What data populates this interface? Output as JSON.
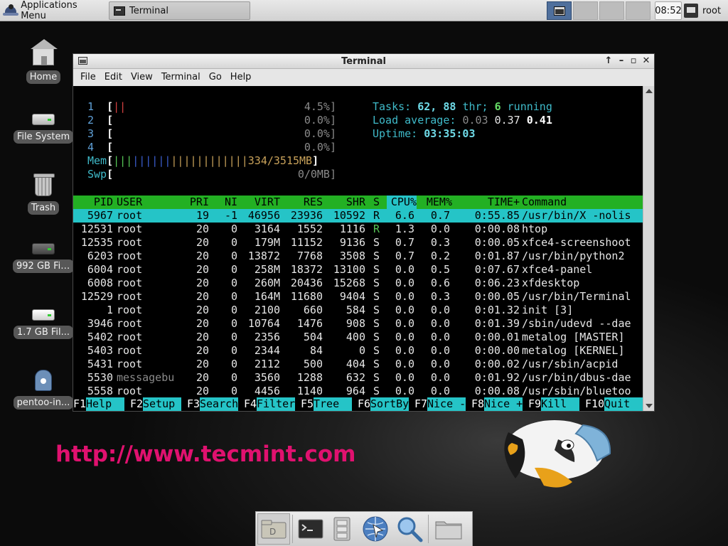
{
  "top_panel": {
    "apps_menu_label": "Applications Menu",
    "task_label": "Terminal",
    "clock": "08:52",
    "user": "root"
  },
  "desktop_icons": [
    {
      "label": "Home",
      "icon": "home-folder-icon"
    },
    {
      "label": "File System",
      "icon": "drive-icon"
    },
    {
      "label": "Trash",
      "icon": "trash-icon"
    },
    {
      "label": "992 GB Fil...",
      "icon": "drive-icon"
    },
    {
      "label": "1.7 GB Fil...",
      "icon": "drive-icon"
    },
    {
      "label": "pentoo-in...",
      "icon": "installer-icon"
    }
  ],
  "terminal": {
    "title": "Terminal",
    "menu": [
      "File",
      "Edit",
      "View",
      "Terminal",
      "Go",
      "Help"
    ]
  },
  "htop": {
    "cpus": [
      {
        "n": "1",
        "bars": "||",
        "pct": "4.5%]"
      },
      {
        "n": "2",
        "bars": "",
        "pct": "0.0%]"
      },
      {
        "n": "3",
        "bars": "",
        "pct": "0.0%]"
      },
      {
        "n": "4",
        "bars": "",
        "pct": "0.0%]"
      }
    ],
    "mem_label": "Mem",
    "mem_value": "334/3515MB",
    "swp_label": "Swp",
    "swp_value": "0/0MB]",
    "tasks_label": "Tasks:",
    "tasks_count": "62,",
    "threads": "88",
    "thr_label": "thr;",
    "running_count": "6",
    "running_label": "running",
    "load_label": "Load average:",
    "load_1": "0.03",
    "load_5": "0.37",
    "load_15": "0.41",
    "uptime_label": "Uptime:",
    "uptime": "03:35:03",
    "headers": {
      "pid": "PID",
      "user": "USER",
      "pri": "PRI",
      "ni": "NI",
      "virt": "VIRT",
      "res": "RES",
      "shr": "SHR",
      "s": "S",
      "cpu": "CPU%",
      "mem": "MEM%",
      "time": "TIME+",
      "cmd": "Command"
    },
    "processes": [
      {
        "pid": "5967",
        "user": "root",
        "pri": "19",
        "ni": "-1",
        "virt": "46956",
        "res": "23936",
        "shr": "10592",
        "s": "R",
        "cpu": "6.6",
        "mem": "0.7",
        "time": "0:55.85",
        "cmd": "/usr/bin/X -nolis"
      },
      {
        "pid": "12531",
        "user": "root",
        "pri": "20",
        "ni": "0",
        "virt": "3164",
        "res": "1552",
        "shr": "1116",
        "s": "R",
        "cpu": "1.3",
        "mem": "0.0",
        "time": "0:00.08",
        "cmd": "htop"
      },
      {
        "pid": "12535",
        "user": "root",
        "pri": "20",
        "ni": "0",
        "virt": "179M",
        "res": "11152",
        "shr": "9136",
        "s": "S",
        "cpu": "0.7",
        "mem": "0.3",
        "time": "0:00.05",
        "cmd": "xfce4-screenshoot"
      },
      {
        "pid": "6203",
        "user": "root",
        "pri": "20",
        "ni": "0",
        "virt": "13872",
        "res": "7768",
        "shr": "3508",
        "s": "S",
        "cpu": "0.7",
        "mem": "0.2",
        "time": "0:01.87",
        "cmd": "/usr/bin/python2"
      },
      {
        "pid": "6004",
        "user": "root",
        "pri": "20",
        "ni": "0",
        "virt": "258M",
        "res": "18372",
        "shr": "13100",
        "s": "S",
        "cpu": "0.0",
        "mem": "0.5",
        "time": "0:07.67",
        "cmd": "xfce4-panel"
      },
      {
        "pid": "6008",
        "user": "root",
        "pri": "20",
        "ni": "0",
        "virt": "260M",
        "res": "20436",
        "shr": "15268",
        "s": "S",
        "cpu": "0.0",
        "mem": "0.6",
        "time": "0:06.23",
        "cmd": "xfdesktop"
      },
      {
        "pid": "12529",
        "user": "root",
        "pri": "20",
        "ni": "0",
        "virt": "164M",
        "res": "11680",
        "shr": "9404",
        "s": "S",
        "cpu": "0.0",
        "mem": "0.3",
        "time": "0:00.05",
        "cmd": "/usr/bin/Terminal"
      },
      {
        "pid": "1",
        "user": "root",
        "pri": "20",
        "ni": "0",
        "virt": "2100",
        "res": "660",
        "shr": "584",
        "s": "S",
        "cpu": "0.0",
        "mem": "0.0",
        "time": "0:01.32",
        "cmd": "init [3]"
      },
      {
        "pid": "3946",
        "user": "root",
        "pri": "20",
        "ni": "0",
        "virt": "10764",
        "res": "1476",
        "shr": "908",
        "s": "S",
        "cpu": "0.0",
        "mem": "0.0",
        "time": "0:01.39",
        "cmd": "/sbin/udevd --dae"
      },
      {
        "pid": "5402",
        "user": "root",
        "pri": "20",
        "ni": "0",
        "virt": "2356",
        "res": "504",
        "shr": "400",
        "s": "S",
        "cpu": "0.0",
        "mem": "0.0",
        "time": "0:00.01",
        "cmd": "metalog [MASTER]"
      },
      {
        "pid": "5403",
        "user": "root",
        "pri": "20",
        "ni": "0",
        "virt": "2344",
        "res": "84",
        "shr": "0",
        "s": "S",
        "cpu": "0.0",
        "mem": "0.0",
        "time": "0:00.00",
        "cmd": "metalog [KERNEL]"
      },
      {
        "pid": "5431",
        "user": "root",
        "pri": "20",
        "ni": "0",
        "virt": "2112",
        "res": "500",
        "shr": "404",
        "s": "S",
        "cpu": "0.0",
        "mem": "0.0",
        "time": "0:00.02",
        "cmd": "/usr/sbin/acpid"
      },
      {
        "pid": "5530",
        "user": "messagebu",
        "pri": "20",
        "ni": "0",
        "virt": "3560",
        "res": "1288",
        "shr": "632",
        "s": "S",
        "cpu": "0.0",
        "mem": "0.0",
        "time": "0:01.92",
        "cmd": "/usr/bin/dbus-dae"
      },
      {
        "pid": "5558",
        "user": "root",
        "pri": "20",
        "ni": "0",
        "virt": "4456",
        "res": "1140",
        "shr": "964",
        "s": "S",
        "cpu": "0.0",
        "mem": "0.0",
        "time": "0:00.08",
        "cmd": "/usr/sbin/bluetoo"
      }
    ],
    "fkeys": [
      {
        "key": "F1",
        "label": "Help  "
      },
      {
        "key": "F2",
        "label": "Setup "
      },
      {
        "key": "F3",
        "label": "Search"
      },
      {
        "key": "F4",
        "label": "Filter"
      },
      {
        "key": "F5",
        "label": "Tree  "
      },
      {
        "key": "F6",
        "label": "SortBy"
      },
      {
        "key": "F7",
        "label": "Nice -"
      },
      {
        "key": "F8",
        "label": "Nice +"
      },
      {
        "key": "F9",
        "label": "Kill  "
      },
      {
        "key": "F10",
        "label": "Quit  "
      }
    ]
  },
  "watermark": "http://www.tecmint.com",
  "dock_items": [
    "file-manager-icon",
    "terminal-icon",
    "file-cabinet-icon",
    "web-browser-icon",
    "search-icon",
    "folder-icon"
  ],
  "colors": {
    "htop_header_bg": "#23b023",
    "htop_selection": "#25c4c7",
    "watermark": "#e0116f"
  }
}
